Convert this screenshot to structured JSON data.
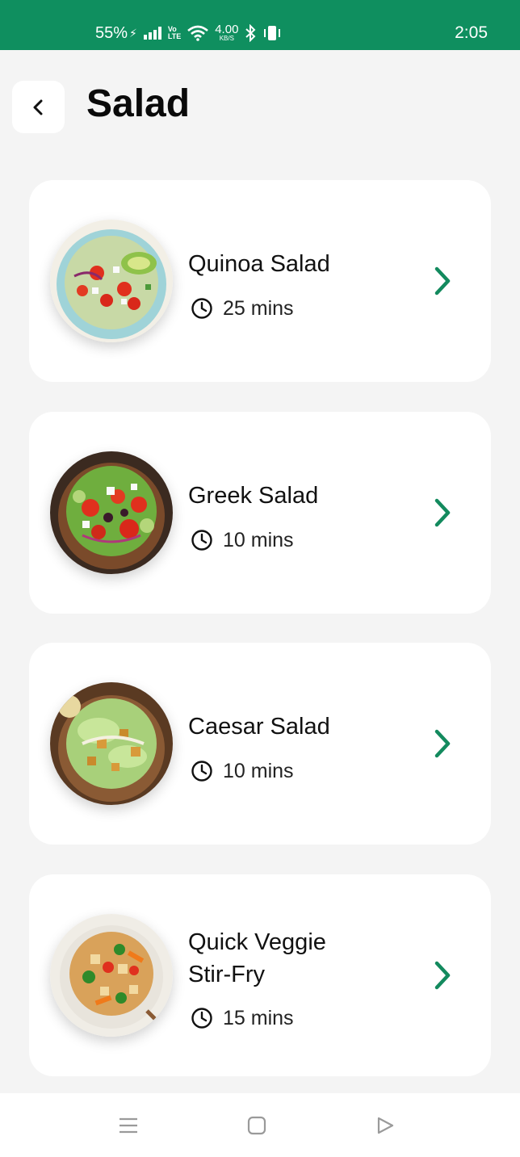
{
  "status_bar": {
    "battery": "55%",
    "network_label_top": "Vo",
    "network_label_bottom": "LTE",
    "speed_value": "4.00",
    "speed_unit": "KB/S",
    "time": "2:05"
  },
  "header": {
    "title": "Salad",
    "back_icon": "chevron-left-icon"
  },
  "recipes": [
    {
      "title_line1": "Quinoa Salad",
      "title_line2": "",
      "time": "25 mins",
      "image": "quinoa-salad-photo"
    },
    {
      "title_line1": "Greek Salad",
      "title_line2": "",
      "time": "10 mins",
      "image": "greek-salad-photo"
    },
    {
      "title_line1": "Caesar Salad",
      "title_line2": "",
      "time": "10 mins",
      "image": "caesar-salad-photo"
    },
    {
      "title_line1": "Quick Veggie",
      "title_line2": "Stir-Fry",
      "time": "15 mins",
      "image": "veggie-stir-fry-photo"
    }
  ],
  "nav_bar": {
    "menu_icon": "menu-icon",
    "home_icon": "home-square-icon",
    "back_icon": "back-triangle-icon"
  },
  "colors": {
    "brand_green": "#0f8f5f",
    "accent_chevron": "#138a5e",
    "background": "#f4f4f4",
    "card": "#ffffff"
  }
}
